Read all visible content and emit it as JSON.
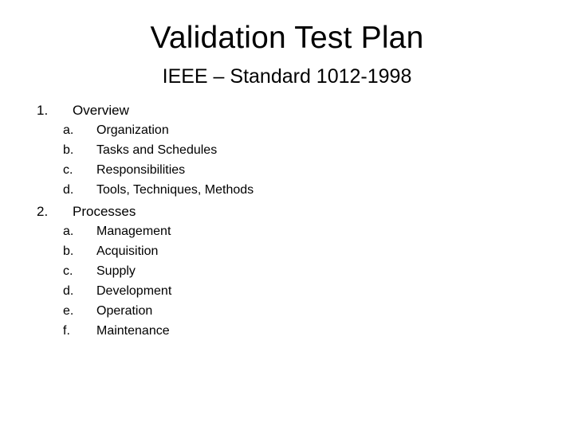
{
  "slide": {
    "title": "Validation Test Plan",
    "subtitle": "IEEE – Standard 1012-1998"
  },
  "outline": [
    {
      "number": "1.",
      "label": "Overview",
      "items": [
        {
          "marker": "a.",
          "label": "Organization"
        },
        {
          "marker": "b.",
          "label": "Tasks and Schedules"
        },
        {
          "marker": "c.",
          "label": "Responsibilities"
        },
        {
          "marker": "d.",
          "label": "Tools, Techniques, Methods"
        }
      ]
    },
    {
      "number": "2.",
      "label": "Processes",
      "items": [
        {
          "marker": "a.",
          "label": "Management"
        },
        {
          "marker": "b.",
          "label": "Acquisition"
        },
        {
          "marker": "c.",
          "label": "Supply"
        },
        {
          "marker": "d.",
          "label": "Development"
        },
        {
          "marker": "e.",
          "label": "Operation"
        },
        {
          "marker": "f.",
          "label": "Maintenance"
        }
      ]
    }
  ]
}
